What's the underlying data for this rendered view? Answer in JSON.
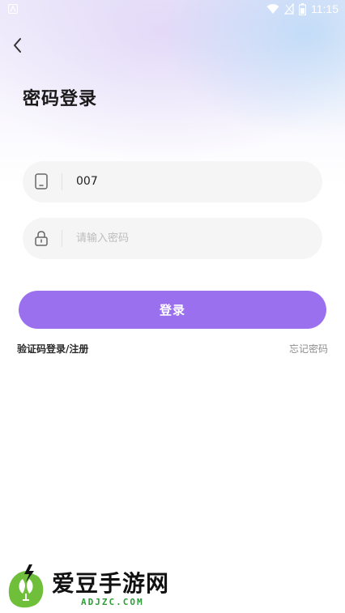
{
  "status_bar": {
    "time": "11:15",
    "icons": [
      "app-notification-icon",
      "wifi-icon",
      "signal-icon",
      "battery-icon"
    ]
  },
  "header": {
    "back_icon": "chevron-left-icon",
    "title": "密码登录"
  },
  "form": {
    "phone": {
      "icon": "phone-icon",
      "value": "007"
    },
    "password": {
      "icon": "lock-icon",
      "placeholder": "请输入密码",
      "value": ""
    },
    "login_button": "登录",
    "sms_login_link": "验证码登录/注册",
    "forgot_password_link": "忘记密码"
  },
  "watermark": {
    "text_cn": "爱豆手游网",
    "text_en": "ADJZC.COM"
  },
  "colors": {
    "accent": "#9a70ef",
    "field_bg": "#f5f5f5",
    "watermark_green": "#2f9e3a"
  }
}
